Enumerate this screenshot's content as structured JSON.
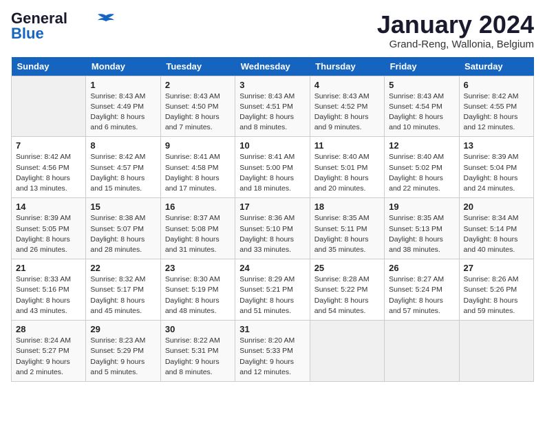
{
  "header": {
    "logo_line1": "General",
    "logo_line2": "Blue",
    "month": "January 2024",
    "location": "Grand-Reng, Wallonia, Belgium"
  },
  "columns": [
    "Sunday",
    "Monday",
    "Tuesday",
    "Wednesday",
    "Thursday",
    "Friday",
    "Saturday"
  ],
  "weeks": [
    [
      {
        "day": "",
        "info": ""
      },
      {
        "day": "1",
        "info": "Sunrise: 8:43 AM\nSunset: 4:49 PM\nDaylight: 8 hours\nand 6 minutes."
      },
      {
        "day": "2",
        "info": "Sunrise: 8:43 AM\nSunset: 4:50 PM\nDaylight: 8 hours\nand 7 minutes."
      },
      {
        "day": "3",
        "info": "Sunrise: 8:43 AM\nSunset: 4:51 PM\nDaylight: 8 hours\nand 8 minutes."
      },
      {
        "day": "4",
        "info": "Sunrise: 8:43 AM\nSunset: 4:52 PM\nDaylight: 8 hours\nand 9 minutes."
      },
      {
        "day": "5",
        "info": "Sunrise: 8:43 AM\nSunset: 4:54 PM\nDaylight: 8 hours\nand 10 minutes."
      },
      {
        "day": "6",
        "info": "Sunrise: 8:42 AM\nSunset: 4:55 PM\nDaylight: 8 hours\nand 12 minutes."
      }
    ],
    [
      {
        "day": "7",
        "info": "Sunrise: 8:42 AM\nSunset: 4:56 PM\nDaylight: 8 hours\nand 13 minutes."
      },
      {
        "day": "8",
        "info": "Sunrise: 8:42 AM\nSunset: 4:57 PM\nDaylight: 8 hours\nand 15 minutes."
      },
      {
        "day": "9",
        "info": "Sunrise: 8:41 AM\nSunset: 4:58 PM\nDaylight: 8 hours\nand 17 minutes."
      },
      {
        "day": "10",
        "info": "Sunrise: 8:41 AM\nSunset: 5:00 PM\nDaylight: 8 hours\nand 18 minutes."
      },
      {
        "day": "11",
        "info": "Sunrise: 8:40 AM\nSunset: 5:01 PM\nDaylight: 8 hours\nand 20 minutes."
      },
      {
        "day": "12",
        "info": "Sunrise: 8:40 AM\nSunset: 5:02 PM\nDaylight: 8 hours\nand 22 minutes."
      },
      {
        "day": "13",
        "info": "Sunrise: 8:39 AM\nSunset: 5:04 PM\nDaylight: 8 hours\nand 24 minutes."
      }
    ],
    [
      {
        "day": "14",
        "info": "Sunrise: 8:39 AM\nSunset: 5:05 PM\nDaylight: 8 hours\nand 26 minutes."
      },
      {
        "day": "15",
        "info": "Sunrise: 8:38 AM\nSunset: 5:07 PM\nDaylight: 8 hours\nand 28 minutes."
      },
      {
        "day": "16",
        "info": "Sunrise: 8:37 AM\nSunset: 5:08 PM\nDaylight: 8 hours\nand 31 minutes."
      },
      {
        "day": "17",
        "info": "Sunrise: 8:36 AM\nSunset: 5:10 PM\nDaylight: 8 hours\nand 33 minutes."
      },
      {
        "day": "18",
        "info": "Sunrise: 8:35 AM\nSunset: 5:11 PM\nDaylight: 8 hours\nand 35 minutes."
      },
      {
        "day": "19",
        "info": "Sunrise: 8:35 AM\nSunset: 5:13 PM\nDaylight: 8 hours\nand 38 minutes."
      },
      {
        "day": "20",
        "info": "Sunrise: 8:34 AM\nSunset: 5:14 PM\nDaylight: 8 hours\nand 40 minutes."
      }
    ],
    [
      {
        "day": "21",
        "info": "Sunrise: 8:33 AM\nSunset: 5:16 PM\nDaylight: 8 hours\nand 43 minutes."
      },
      {
        "day": "22",
        "info": "Sunrise: 8:32 AM\nSunset: 5:17 PM\nDaylight: 8 hours\nand 45 minutes."
      },
      {
        "day": "23",
        "info": "Sunrise: 8:30 AM\nSunset: 5:19 PM\nDaylight: 8 hours\nand 48 minutes."
      },
      {
        "day": "24",
        "info": "Sunrise: 8:29 AM\nSunset: 5:21 PM\nDaylight: 8 hours\nand 51 minutes."
      },
      {
        "day": "25",
        "info": "Sunrise: 8:28 AM\nSunset: 5:22 PM\nDaylight: 8 hours\nand 54 minutes."
      },
      {
        "day": "26",
        "info": "Sunrise: 8:27 AM\nSunset: 5:24 PM\nDaylight: 8 hours\nand 57 minutes."
      },
      {
        "day": "27",
        "info": "Sunrise: 8:26 AM\nSunset: 5:26 PM\nDaylight: 8 hours\nand 59 minutes."
      }
    ],
    [
      {
        "day": "28",
        "info": "Sunrise: 8:24 AM\nSunset: 5:27 PM\nDaylight: 9 hours\nand 2 minutes."
      },
      {
        "day": "29",
        "info": "Sunrise: 8:23 AM\nSunset: 5:29 PM\nDaylight: 9 hours\nand 5 minutes."
      },
      {
        "day": "30",
        "info": "Sunrise: 8:22 AM\nSunset: 5:31 PM\nDaylight: 9 hours\nand 8 minutes."
      },
      {
        "day": "31",
        "info": "Sunrise: 8:20 AM\nSunset: 5:33 PM\nDaylight: 9 hours\nand 12 minutes."
      },
      {
        "day": "",
        "info": ""
      },
      {
        "day": "",
        "info": ""
      },
      {
        "day": "",
        "info": ""
      }
    ]
  ]
}
